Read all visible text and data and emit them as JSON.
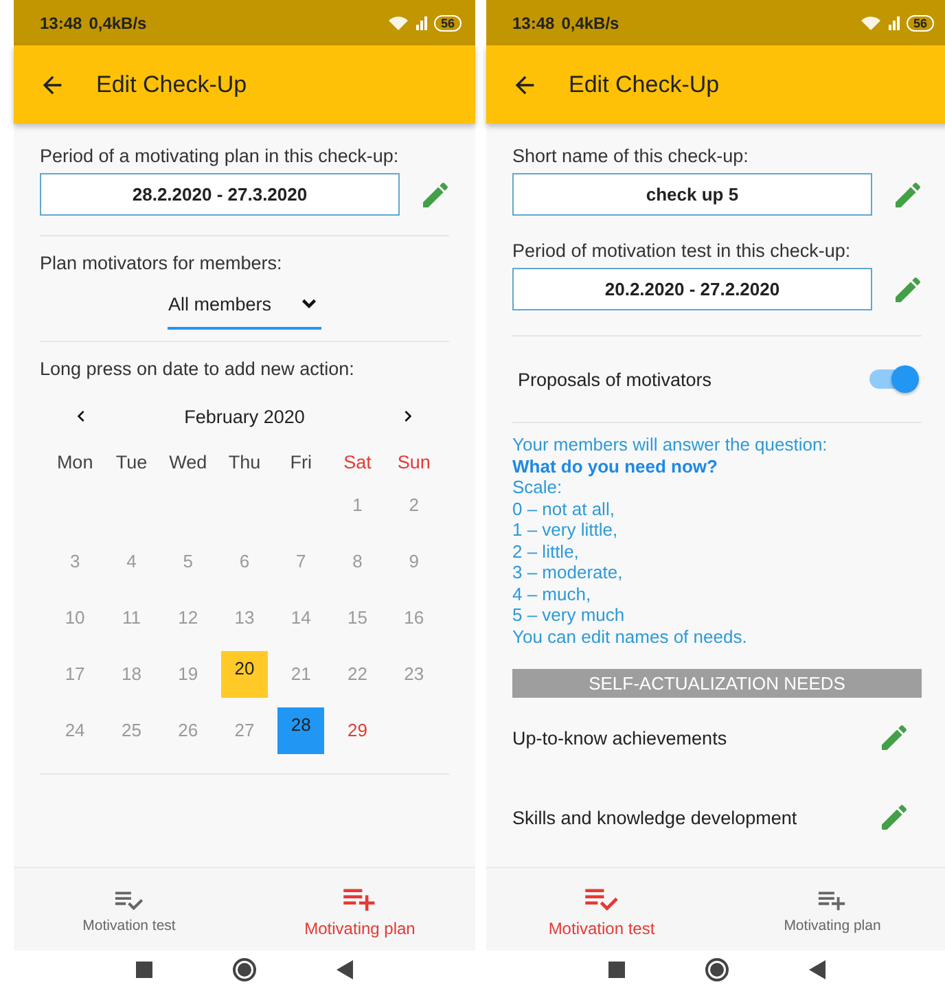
{
  "screens": [
    {
      "status_bar": {
        "time": "13:48",
        "speed": "0,4kB/s",
        "battery": "56"
      },
      "title": "Edit Check-Up",
      "sections": [
        {
          "kind": "field",
          "label": "Period of a motivating plan in this check-up:",
          "value": "28.2.2020 - 27.3.2020"
        },
        {
          "kind": "dropdown",
          "label": "Plan motivators for members:",
          "value": "All members"
        },
        {
          "kind": "calendar",
          "label": "Long press on date to add new action:",
          "month": "February 2020",
          "weekdays": [
            {
              "label": "Mon",
              "weekend": false
            },
            {
              "label": "Tue",
              "weekend": false
            },
            {
              "label": "Wed",
              "weekend": false
            },
            {
              "label": "Thu",
              "weekend": false
            },
            {
              "label": "Fri",
              "weekend": false
            },
            {
              "label": "Sat",
              "weekend": true
            },
            {
              "label": "Sun",
              "weekend": true
            }
          ],
          "weeks": [
            [
              {
                "day": "1",
                "muted": true
              },
              {
                "day": "2",
                "muted": true
              }
            ],
            [
              {
                "day": "3",
                "muted": true
              },
              {
                "day": "4",
                "muted": true
              },
              {
                "day": "5",
                "muted": true
              },
              {
                "day": "6",
                "muted": true
              },
              {
                "day": "7",
                "muted": true
              },
              {
                "day": "8",
                "muted": true
              },
              {
                "day": "9",
                "muted": true
              }
            ],
            [
              {
                "day": "10",
                "muted": true
              },
              {
                "day": "11",
                "muted": true
              },
              {
                "day": "12",
                "muted": true
              },
              {
                "day": "13",
                "muted": true
              },
              {
                "day": "14",
                "muted": true
              },
              {
                "day": "15",
                "muted": true
              },
              {
                "day": "16",
                "muted": true
              }
            ],
            [
              {
                "day": "17",
                "muted": true
              },
              {
                "day": "18",
                "muted": true
              },
              {
                "day": "19",
                "muted": true
              },
              {
                "day": "20",
                "muted": false,
                "weekend": false,
                "color": "#ffca28"
              },
              {
                "day": "21",
                "muted": true
              },
              {
                "day": "22",
                "muted": true
              },
              {
                "day": "23",
                "muted": true
              }
            ],
            [
              {
                "day": "24",
                "muted": true
              },
              {
                "day": "25",
                "muted": true
              },
              {
                "day": "26",
                "muted": true
              },
              {
                "day": "27",
                "muted": true
              },
              {
                "day": "28",
                "muted": false,
                "weekend": false,
                "color": "#2196f3"
              },
              {
                "day": "29",
                "muted": false,
                "weekend": true
              }
            ]
          ]
        }
      ],
      "nav": [
        {
          "kind": "check",
          "label": "Motivation test",
          "selected": false
        },
        {
          "kind": "add",
          "label": "Motivating plan",
          "selected": true
        }
      ]
    },
    {
      "status_bar": {
        "time": "13:48",
        "speed": "0,4kB/s",
        "battery": "56"
      },
      "title": "Edit Check-Up",
      "sections": [
        {
          "kind": "field",
          "label": "Short name of this check-up:",
          "value": "check up 5"
        },
        {
          "kind": "field",
          "label": "Period of motivation test in this check-up:",
          "value": "20.2.2020 - 27.2.2020"
        },
        {
          "kind": "toggle",
          "label": "Proposals of motivators",
          "on": true
        },
        {
          "kind": "info",
          "lines": [
            {
              "text": "Your members will answer the question:",
              "bold": false
            },
            {
              "text": "What do you need now?",
              "bold": true
            },
            {
              "text": "Scale:",
              "bold": false
            },
            {
              "text": "0 – not at all,",
              "bold": false
            },
            {
              "text": "1 – very little,",
              "bold": false
            },
            {
              "text": "2 – little,",
              "bold": false
            },
            {
              "text": "3 – moderate,",
              "bold": false
            },
            {
              "text": "4 – much,",
              "bold": false
            },
            {
              "text": "5 – very much",
              "bold": false
            },
            {
              "text": "You can edit names of needs.",
              "bold": false
            }
          ]
        },
        {
          "kind": "header",
          "label": "SELF-ACTUALIZATION NEEDS"
        },
        {
          "kind": "need",
          "label": "Up-to-know achievements"
        },
        {
          "kind": "need",
          "label": "Skills and knowledge development"
        }
      ],
      "nav": [
        {
          "kind": "check",
          "label": "Motivation test",
          "selected": true
        },
        {
          "kind": "add",
          "label": "Motivating plan",
          "selected": false
        }
      ]
    }
  ]
}
